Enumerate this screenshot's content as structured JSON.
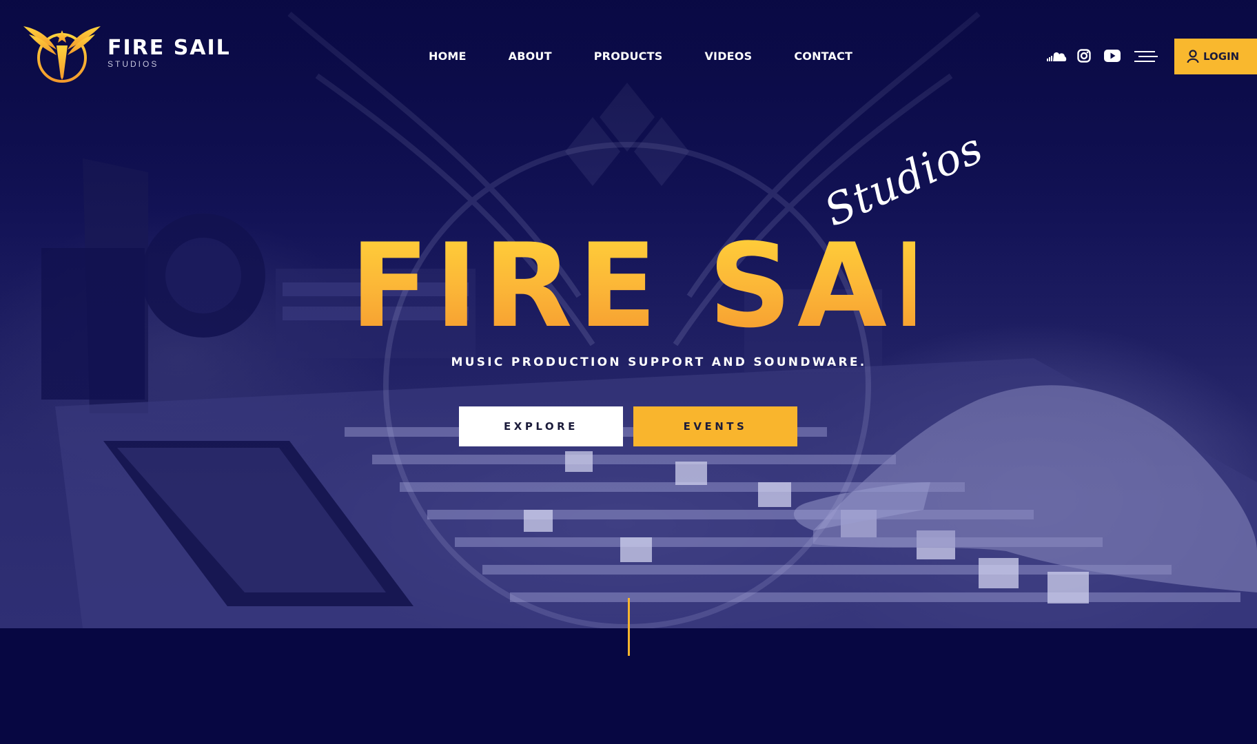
{
  "brand": {
    "name": "FIRE SAIL",
    "sub": "STUDIOS"
  },
  "nav": {
    "items": [
      "HOME",
      "ABOUT",
      "PRODUCTS",
      "VIDEOS",
      "CONTACT"
    ]
  },
  "header_actions": {
    "icons": [
      "soundcloud-icon",
      "instagram-icon",
      "youtube-icon",
      "menu-icon"
    ],
    "login_label": "LOGIN"
  },
  "hero": {
    "title": "FIRE SAIL",
    "script": "Studios",
    "subtitle": "MUSIC PRODUCTION SUPPORT AND SOUNDWARE.",
    "explore_label": "EXPLORE",
    "events_label": "EVENTS"
  },
  "colors": {
    "accent": "#f9b82e",
    "background": "#070742",
    "text": "#ffffff"
  }
}
